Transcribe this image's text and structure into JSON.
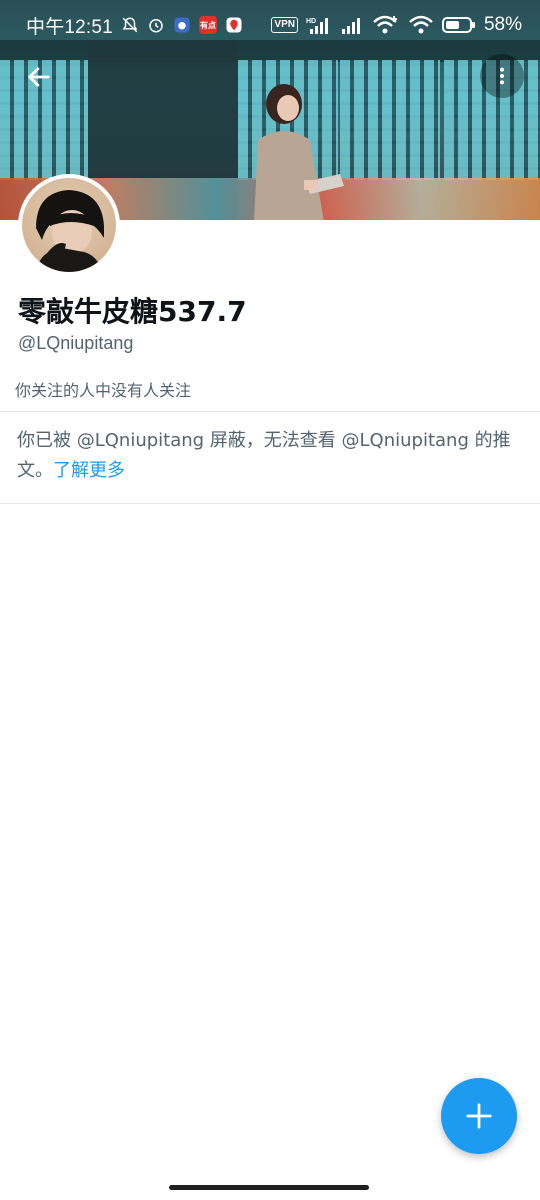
{
  "status_bar": {
    "time": "中午12:51",
    "app_badge_1": "有点",
    "vpn_label": "VPN",
    "hd_label": "HD",
    "battery_percent": "58%",
    "battery_level": 0.58
  },
  "profile": {
    "display_name": "零敲牛皮糖537.7",
    "handle": "@LQniupitang",
    "followers_note": "你关注的人中没有人关注"
  },
  "blocked_notice": {
    "text": "你已被 @LQniupitang 屏蔽，无法查看 @LQniupitang 的推文。",
    "link_label": "了解更多"
  },
  "colors": {
    "accent": "#1d9bf0",
    "secondary_text": "#536471",
    "primary_text": "#0f1419"
  },
  "icons": {
    "back": "arrow-left-icon",
    "more": "more-vertical-icon",
    "fab": "plus-icon"
  }
}
